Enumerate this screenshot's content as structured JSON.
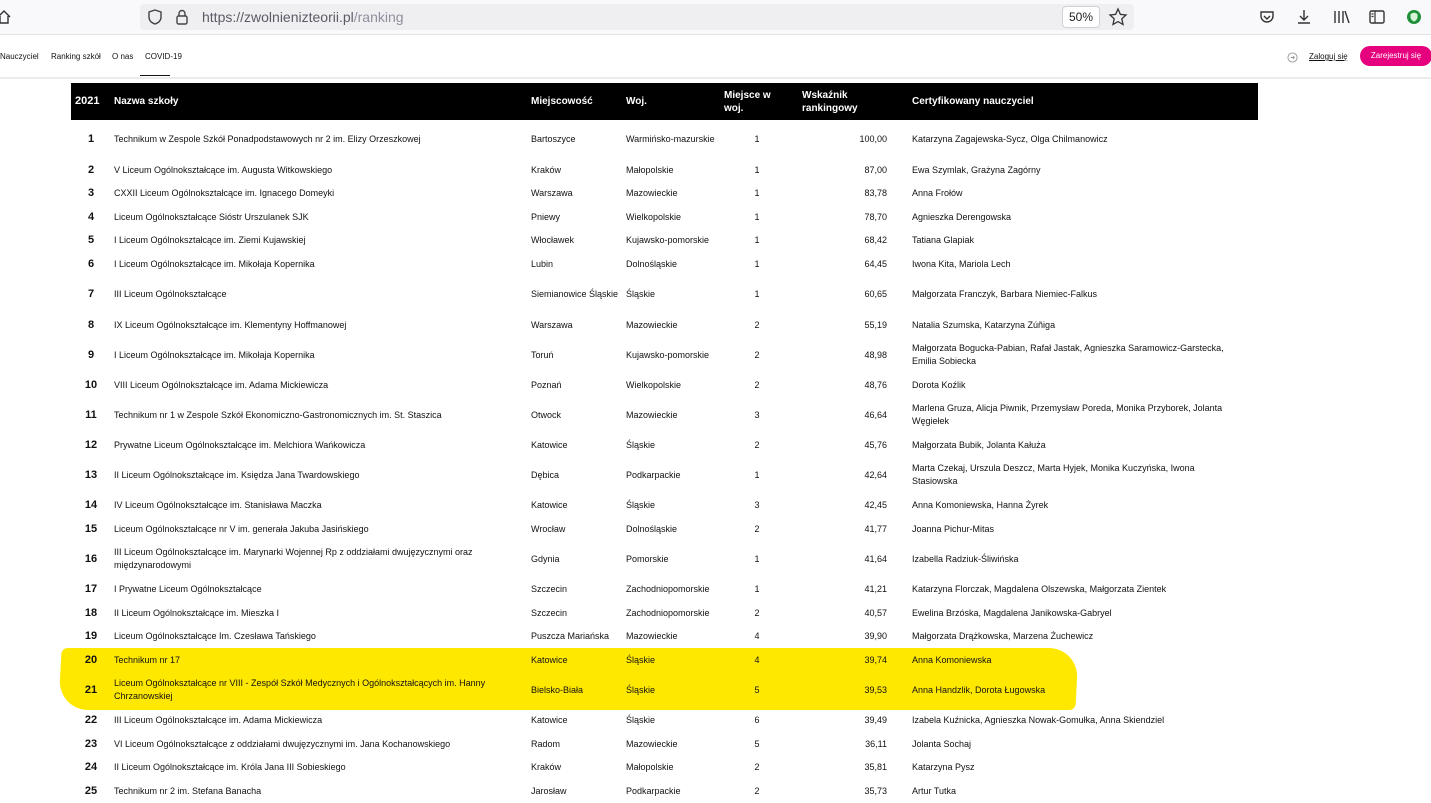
{
  "browser": {
    "url_host": "https://zwolnienizteorii.pl",
    "url_path": "/ranking",
    "zoom": "50%"
  },
  "site_nav": {
    "items": [
      "Nauczyciel",
      "Ranking szkół",
      "O nas",
      "COVID-19"
    ],
    "login": "Zaloguj się",
    "register": "Zarejestruj się"
  },
  "table": {
    "headers": {
      "year": "2021",
      "name": "Nazwa szkoły",
      "city": "Miejscowość",
      "voivodeship": "Woj.",
      "place_line1": "Miejsce w",
      "place_line2": "woj.",
      "score_line1": "Wskaźnik",
      "score_line2": "rankingowy",
      "teachers": "Certyfikowany nauczyciel"
    },
    "rows": [
      {
        "rank": "1",
        "name": "Technikum w Zespole Szkół Ponadpodstawowych nr 2 im. Elizy Orzeszkowej",
        "city": "Bartoszyce",
        "voiv": "Warmińsko-mazurskie",
        "place": "1",
        "score": "100,00",
        "teachers": "Katarzyna Zagajewska-Sycz, Olga Chilmanowicz"
      },
      {
        "rank": "2",
        "name": "V Liceum Ogólnokształcące im. Augusta Witkowskiego",
        "city": "Kraków",
        "voiv": "Małopolskie",
        "place": "1",
        "score": "87,00",
        "teachers": "Ewa Szymlak, Grażyna Zagórny"
      },
      {
        "rank": "3",
        "name": "CXXII Liceum Ogólnokształcące im. Ignacego Domeyki",
        "city": "Warszawa",
        "voiv": "Mazowieckie",
        "place": "1",
        "score": "83,78",
        "teachers": "Anna Frołów"
      },
      {
        "rank": "4",
        "name": "Liceum Ogólnokształcące Sióstr Urszulanek SJK",
        "city": "Pniewy",
        "voiv": "Wielkopolskie",
        "place": "1",
        "score": "78,70",
        "teachers": "Agnieszka Derengowska"
      },
      {
        "rank": "5",
        "name": "I Liceum Ogólnokształcące im. Ziemi Kujawskiej",
        "city": "Włocławek",
        "voiv": "Kujawsko-pomorskie",
        "place": "1",
        "score": "68,42",
        "teachers": "Tatiana Glapiak"
      },
      {
        "rank": "6",
        "name": "I Liceum Ogólnokształcące im. Mikołaja Kopernika",
        "city": "Lubin",
        "voiv": "Dolnośląskie",
        "place": "1",
        "score": "64,45",
        "teachers": "Iwona Kita, Mariola Lech"
      },
      {
        "rank": "7",
        "name": "III Liceum Ogólnokształcące",
        "city": "Siemianowice Śląskie",
        "voiv": "Śląskie",
        "place": "1",
        "score": "60,65",
        "teachers": "Małgorzata Franczyk, Barbara Niemiec-Falkus"
      },
      {
        "rank": "8",
        "name": "IX Liceum Ogólnokształcące im. Klementyny Hoffmanowej",
        "city": "Warszawa",
        "voiv": "Mazowieckie",
        "place": "2",
        "score": "55,19",
        "teachers": "Natalia Szumska, Katarzyna Zúñiga"
      },
      {
        "rank": "9",
        "name": "I Liceum Ogólnokształcące im. Mikołaja Kopernika",
        "city": "Toruń",
        "voiv": "Kujawsko-pomorskie",
        "place": "2",
        "score": "48,98",
        "teachers": "Małgorzata Bogucka-Pabian, Rafał Jastak, Agnieszka Saramowicz-Garstecka, Emilia Sobiecka"
      },
      {
        "rank": "10",
        "name": "VIII Liceum Ogólnokształcące im. Adama Mickiewicza",
        "city": "Poznań",
        "voiv": "Wielkopolskie",
        "place": "2",
        "score": "48,76",
        "teachers": "Dorota Koźlik"
      },
      {
        "rank": "11",
        "name": "Technikum nr 1 w Zespole Szkół Ekonomiczno-Gastronomicznych im. St. Staszica",
        "city": "Otwock",
        "voiv": "Mazowieckie",
        "place": "3",
        "score": "46,64",
        "teachers": "Marlena Gruza, Alicja Piwnik, Przemysław Poreda, Monika Przyborek, Jolanta Węgiełek"
      },
      {
        "rank": "12",
        "name": "Prywatne Liceum Ogólnokształcące im. Melchiora Wańkowicza",
        "city": "Katowice",
        "voiv": "Śląskie",
        "place": "2",
        "score": "45,76",
        "teachers": "Małgorzata Bubik, Jolanta Kałuża"
      },
      {
        "rank": "13",
        "name": "II Liceum Ogólnokształcące im. Księdza Jana Twardowskiego",
        "city": "Dębica",
        "voiv": "Podkarpackie",
        "place": "1",
        "score": "42,64",
        "teachers": "Marta Czekaj, Urszula Deszcz, Marta Hyjek, Monika Kuczyńska, Iwona Stasiowska"
      },
      {
        "rank": "14",
        "name": "IV Liceum Ogólnokształcące im. Stanisława Maczka",
        "city": "Katowice",
        "voiv": "Śląskie",
        "place": "3",
        "score": "42,45",
        "teachers": "Anna Komoniewska, Hanna Żyrek"
      },
      {
        "rank": "15",
        "name": "Liceum Ogólnokształcące nr V im. generała Jakuba Jasińskiego",
        "city": "Wrocław",
        "voiv": "Dolnośląskie",
        "place": "2",
        "score": "41,77",
        "teachers": "Joanna Pichur-Mitas"
      },
      {
        "rank": "16",
        "name": "III Liceum Ogólnokształcące im. Marynarki Wojennej Rp z oddziałami dwujęzycznymi oraz międzynarodowymi",
        "city": "Gdynia",
        "voiv": "Pomorskie",
        "place": "1",
        "score": "41,64",
        "teachers": "Izabella Radziuk-Śliwińska"
      },
      {
        "rank": "17",
        "name": "I Prywatne Liceum Ogólnokształcące",
        "city": "Szczecin",
        "voiv": "Zachodniopomorskie",
        "place": "1",
        "score": "41,21",
        "teachers": "Katarzyna Florczak, Magdalena Olszewska, Małgorzata Zientek"
      },
      {
        "rank": "18",
        "name": "II Liceum Ogólnokształcące im. Mieszka I",
        "city": "Szczecin",
        "voiv": "Zachodniopomorskie",
        "place": "2",
        "score": "40,57",
        "teachers": "Ewelina Brzóska, Magdalena Janikowska-Gabryel"
      },
      {
        "rank": "19",
        "name": "Liceum Ogólnokształcące Im. Czesława Tańskiego",
        "city": "Puszcza Mariańska",
        "voiv": "Mazowieckie",
        "place": "4",
        "score": "39,90",
        "teachers": "Małgorzata Drążkowska, Marzena Żuchewicz"
      },
      {
        "rank": "20",
        "name": "Technikum nr 17",
        "city": "Katowice",
        "voiv": "Śląskie",
        "place": "4",
        "score": "39,74",
        "teachers": "Anna Komoniewska"
      },
      {
        "rank": "21",
        "name": "Liceum Ogólnokształcące nr VIII - Zespół Szkół Medycznych i Ogólnokształcących im. Hanny Chrzanowskiej",
        "city": "Bielsko-Biała",
        "voiv": "Śląskie",
        "place": "5",
        "score": "39,53",
        "teachers": "Anna Handzlik, Dorota Ługowska"
      },
      {
        "rank": "22",
        "name": "III Liceum Ogólnokształcące im. Adama Mickiewicza",
        "city": "Katowice",
        "voiv": "Śląskie",
        "place": "6",
        "score": "39,49",
        "teachers": "Izabela Kuźnicka, Agnieszka Nowak-Gomułka, Anna Skiendziel"
      },
      {
        "rank": "23",
        "name": "VI Liceum Ogólnokształcące z oddziałami dwujęzycznymi im. Jana Kochanowskiego",
        "city": "Radom",
        "voiv": "Mazowieckie",
        "place": "5",
        "score": "36,11",
        "teachers": "Jolanta Sochaj"
      },
      {
        "rank": "24",
        "name": "II Liceum Ogólnokształcące im. Króla Jana III Sobieskiego",
        "city": "Kraków",
        "voiv": "Małopolskie",
        "place": "2",
        "score": "35,81",
        "teachers": "Katarzyna Pysz"
      },
      {
        "rank": "25",
        "name": "Technikum nr 2 im. Stefana Banacha",
        "city": "Jarosław",
        "voiv": "Podkarpackie",
        "place": "2",
        "score": "35,73",
        "teachers": "Artur Tutka"
      }
    ]
  }
}
